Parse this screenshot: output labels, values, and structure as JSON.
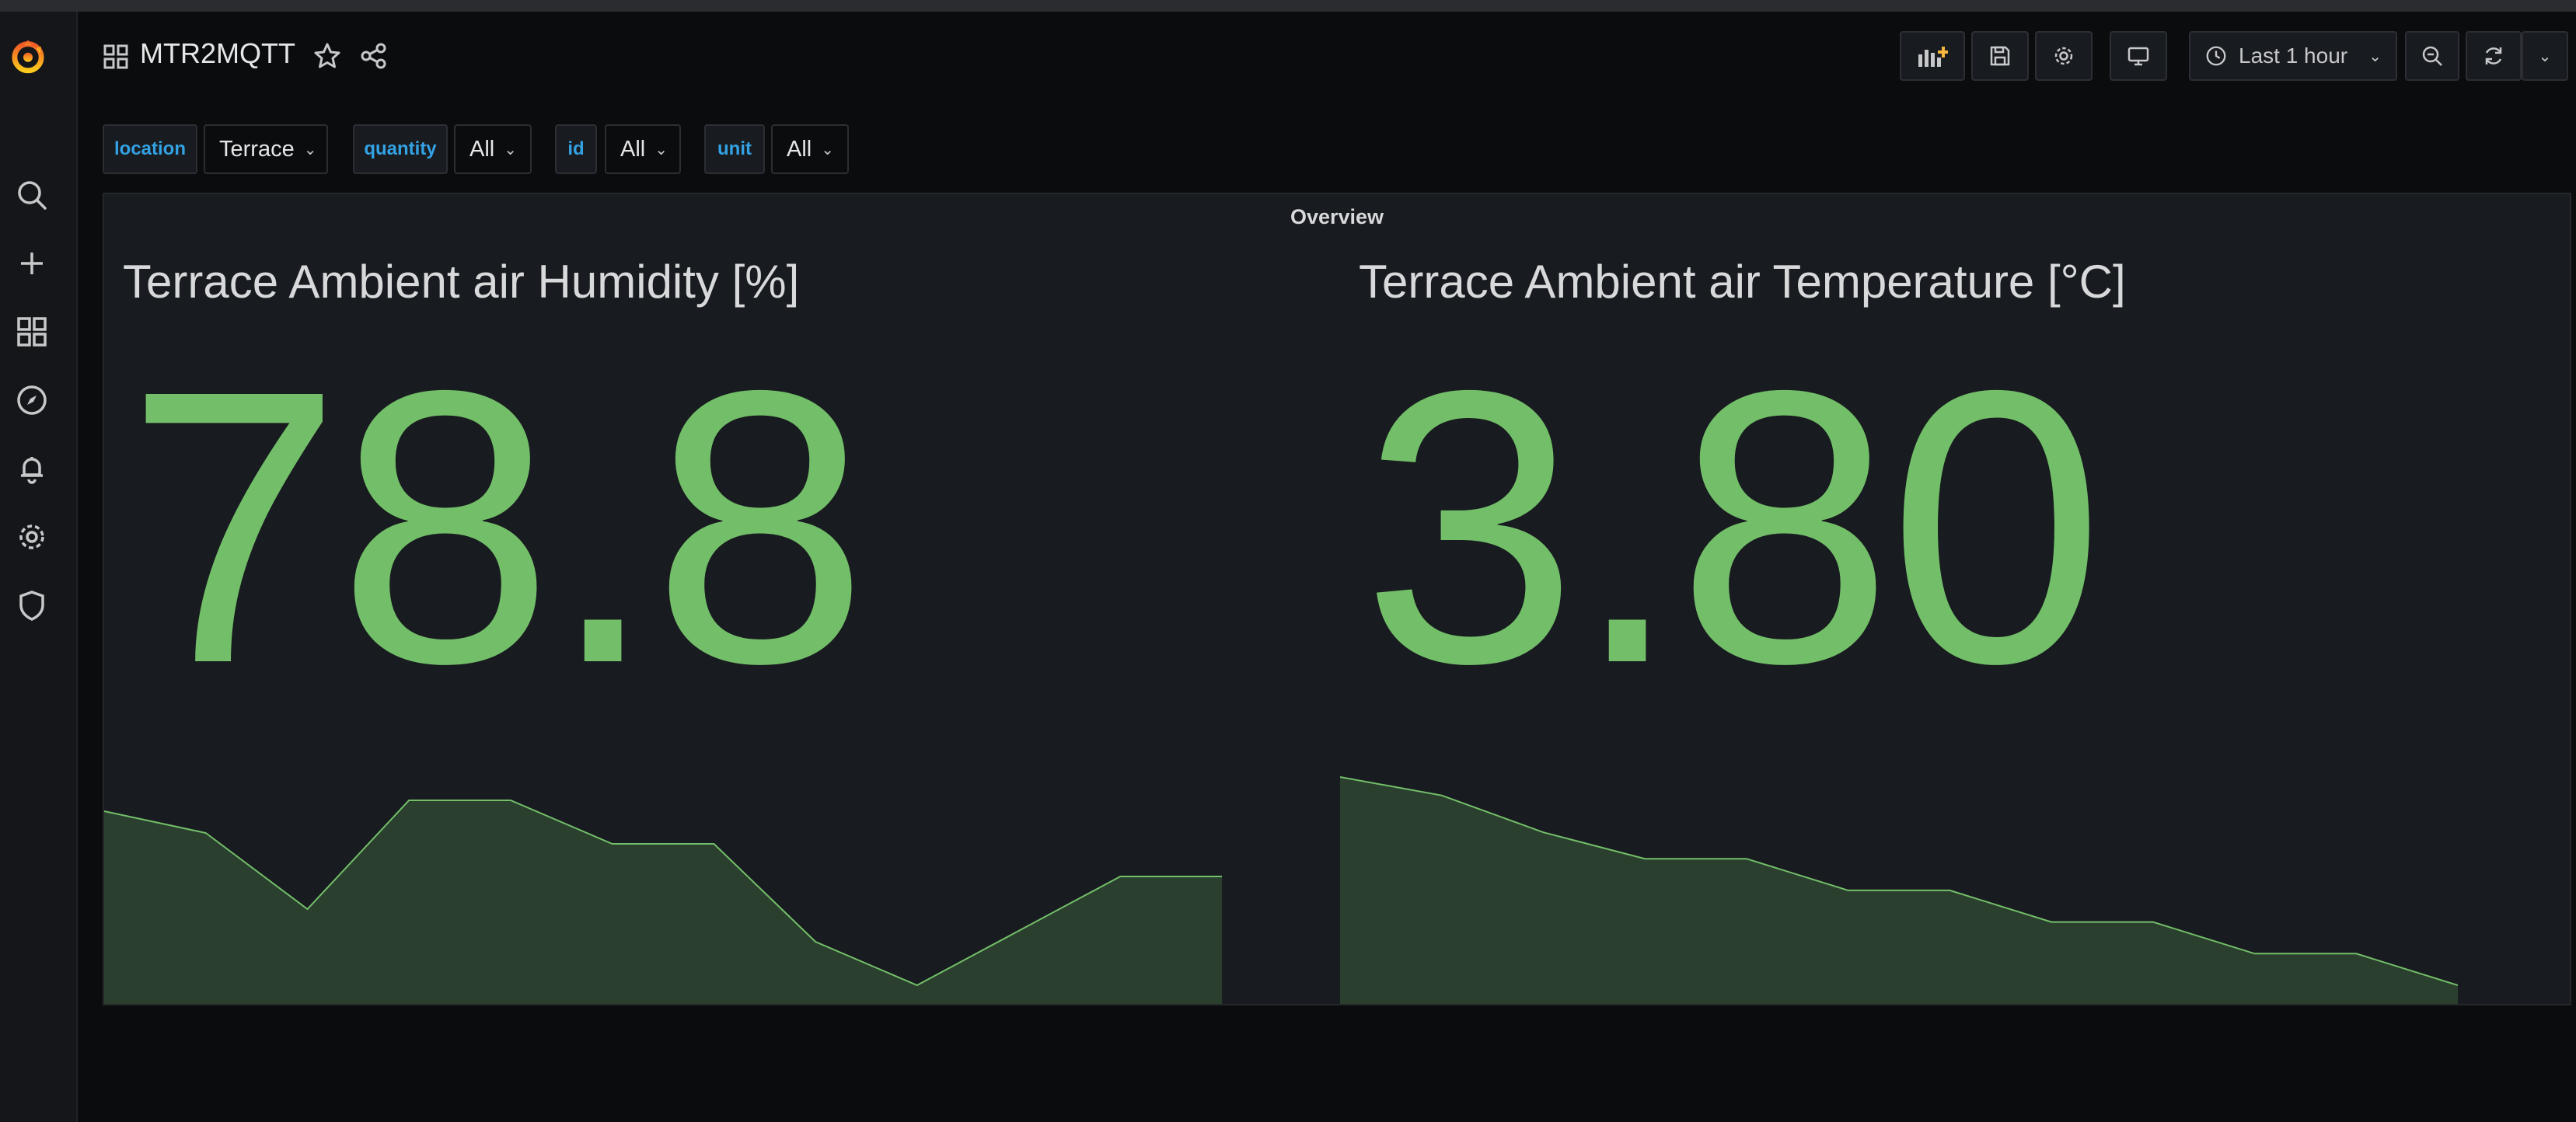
{
  "dashboard": {
    "title": "MTR2MQTT"
  },
  "toolbar": {
    "time_range": "Last 1 hour"
  },
  "variables": [
    {
      "name": "location",
      "value": "Terrace"
    },
    {
      "name": "quantity",
      "value": "All"
    },
    {
      "name": "id",
      "value": "All"
    },
    {
      "name": "unit",
      "value": "All"
    }
  ],
  "panel": {
    "title": "Overview",
    "stats": [
      {
        "title": "Terrace Ambient air Humidity [%]",
        "value": "78.8",
        "sparkline": [
          79.1,
          78.9,
          78.2,
          79.2,
          79.2,
          78.8,
          78.8,
          77.9,
          77.5,
          78.0,
          78.5,
          78.5
        ]
      },
      {
        "title": "Terrace Ambient air Temperature [°C]",
        "value": "3.80",
        "sparkline": [
          4.62,
          4.55,
          4.41,
          4.31,
          4.31,
          4.19,
          4.19,
          4.07,
          4.07,
          3.95,
          3.95,
          3.83
        ]
      }
    ]
  },
  "colors": {
    "accent": "#73bf69",
    "link": "#33a2e5",
    "brand": "#f46800"
  }
}
